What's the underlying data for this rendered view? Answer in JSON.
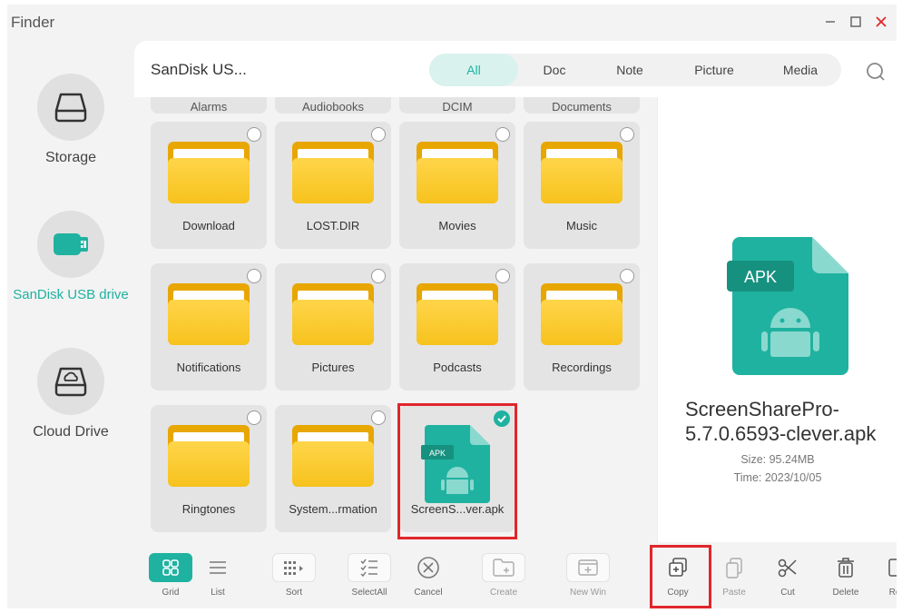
{
  "window": {
    "title": "Finder"
  },
  "sidebar": {
    "items": [
      {
        "label": "Storage",
        "icon": "hard-drive-icon",
        "active": false
      },
      {
        "label": "SanDisk USB drive",
        "icon": "usb-drive-icon",
        "active": true
      },
      {
        "label": "Cloud Drive",
        "icon": "cloud-drive-icon",
        "active": false
      }
    ]
  },
  "header": {
    "breadcrumb": "SanDisk US...",
    "tabs": [
      {
        "label": "All",
        "active": true
      },
      {
        "label": "Doc",
        "active": false
      },
      {
        "label": "Note",
        "active": false
      },
      {
        "label": "Picture",
        "active": false
      },
      {
        "label": "Media",
        "active": false
      }
    ],
    "search_icon": "search-icon"
  },
  "files": {
    "partial_row": [
      "Alarms",
      "Audiobooks",
      "DCIM",
      "Documents"
    ],
    "rows": [
      [
        "Download",
        "LOST.DIR",
        "Movies",
        "Music"
      ],
      [
        "Notifications",
        "Pictures",
        "Podcasts",
        "Recordings"
      ],
      [
        "Ringtones",
        "System...rmation",
        "ScreenS...ver.apk"
      ]
    ],
    "apk_badge": "APK"
  },
  "preview": {
    "badge": "APK",
    "file_name": "ScreenSharePro-5.7.0.6593-clever.apk",
    "size": "Size: 95.24MB",
    "time": "Time: 2023/10/05"
  },
  "toolbar": {
    "grid": "Grid",
    "list": "List",
    "sort": "Sort",
    "select_all": "SelectAll",
    "cancel": "Cancel",
    "create": "Create",
    "new_win": "New Win",
    "copy": "Copy",
    "paste": "Paste",
    "cut": "Cut",
    "delete": "Delete",
    "rename": "Re"
  },
  "colors": {
    "accent": "#1fb2a0",
    "folder": "#f6c21d",
    "highlight": "#e0262a"
  }
}
